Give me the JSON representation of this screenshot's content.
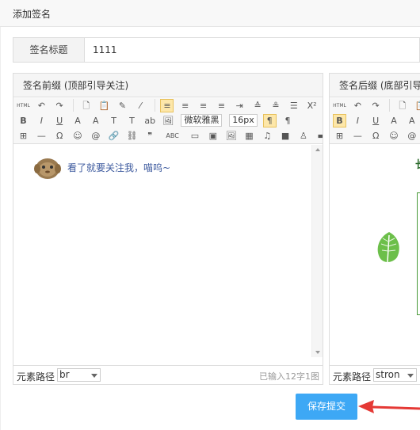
{
  "dialog": {
    "title": "添加签名"
  },
  "title_field": {
    "label": "签名标题",
    "value": "1111"
  },
  "left_editor": {
    "heading": "签名前缀 (顶部引导关注)",
    "content_text": "看了就要关注我，喵呜~",
    "font_family": "微软雅黑",
    "font_size": "16px",
    "path_label": "元素路径",
    "path_value": "br",
    "word_count": "已输入12字1图"
  },
  "right_editor": {
    "heading": "签名后缀 (底部引导关注",
    "content_char": "长",
    "path_label": "元素路径",
    "path_value": "stron"
  },
  "toolbar": {
    "row1": [
      "HTML",
      "↶",
      "↷",
      "🗋",
      "📋",
      "✎",
      "⁄",
      "≡",
      "≡",
      "≡",
      "≡",
      "⇥",
      "≙",
      "≗",
      "☰",
      "X²",
      "X₂"
    ],
    "row2": [
      "B",
      "I",
      "U",
      "A",
      "A",
      "T",
      "T",
      "ab",
      "🖼"
    ],
    "row2b": [
      "¶",
      "¶"
    ],
    "row3": [
      "⊞",
      "—",
      "Ω",
      "☺",
      "@",
      "🔗",
      "⛓",
      "❞",
      "ABC",
      "▭",
      "▣",
      "🖼",
      "▦",
      "♫",
      "■",
      "♙",
      "▬"
    ]
  },
  "actions": {
    "save_label": "保存提交"
  },
  "colors": {
    "accent": "#3da8f5",
    "arrow": "#e53935",
    "link_text": "#3d5a9e",
    "green": "#4a9a3a"
  }
}
